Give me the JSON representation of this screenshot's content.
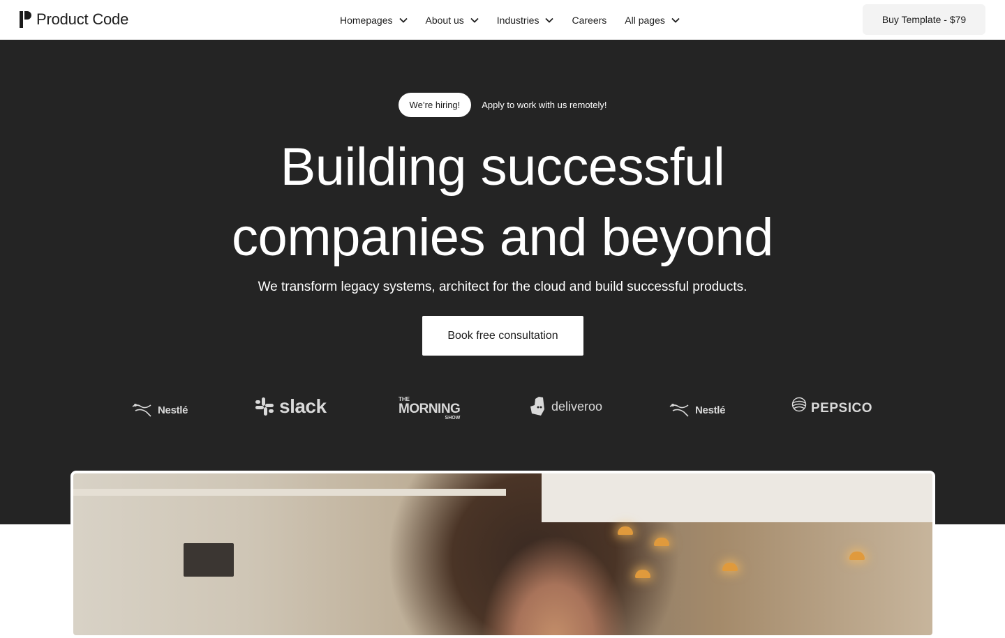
{
  "brand": {
    "name": "Product Code"
  },
  "nav": {
    "items": [
      {
        "label": "Homepages",
        "has_dropdown": true
      },
      {
        "label": "About us",
        "has_dropdown": true
      },
      {
        "label": "Industries",
        "has_dropdown": true
      },
      {
        "label": "Careers",
        "has_dropdown": false
      },
      {
        "label": "All pages",
        "has_dropdown": true
      }
    ],
    "cta_label": "Buy Template - $79"
  },
  "hero": {
    "hiring_badge": "We’re hiring!",
    "hiring_link": "Apply to work with us remotely!",
    "title_line1": "Building successful",
    "title_line2": "companies and beyond",
    "subtitle": "We transform legacy systems, architect for the cloud and build successful products.",
    "cta_label": "Book free consultation"
  },
  "clients": {
    "logos": [
      {
        "name": "Nestle",
        "text": "Nestlé",
        "icon": "nest-icon"
      },
      {
        "name": "Slack",
        "text": "slack",
        "icon": "slack-icon"
      },
      {
        "name": "The Morning Show",
        "text_top": "THE",
        "text_main": "MORNING",
        "text_bottom": "SHOW"
      },
      {
        "name": "Deliveroo",
        "text": "deliveroo",
        "icon": "kangaroo-icon"
      },
      {
        "name": "Nestle",
        "text": "Nestlé",
        "icon": "nest-icon"
      },
      {
        "name": "PepsiCo",
        "text": "PEPSICO",
        "icon": "globe-icon"
      }
    ]
  },
  "colors": {
    "hero_bg": "#242424",
    "nav_bg": "#ffffff",
    "text_dark": "#1b1b1b",
    "text_light": "#ffffff",
    "logo_gray": "#d9d9d9",
    "buy_btn_bg": "#f3f3f3"
  },
  "media": {
    "hero_image": "photo-woman-in-cafe"
  }
}
